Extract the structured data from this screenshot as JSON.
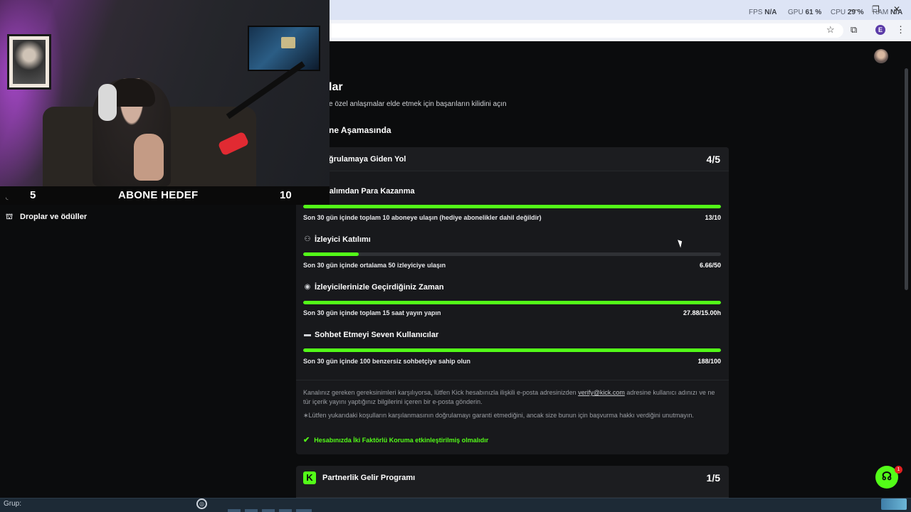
{
  "perf": {
    "fps_label": "FPS",
    "fps_value": "N/A",
    "gpu_label": "GPU",
    "gpu_value": "61 %",
    "cpu_label": "CPU",
    "cpu_value": "29 %",
    "ram_label": "RAM",
    "ram_value": "N/A"
  },
  "browser": {
    "profile_initial": "E",
    "window_controls": {
      "minimize": "—",
      "restore": "❐",
      "close": "✕"
    }
  },
  "page": {
    "title": "lar",
    "subtitle": "e özel anlaşmalar elde etmek için başarıların kilidini açın",
    "stage": "ne Aşamasında"
  },
  "card": {
    "title": "ğrulamaya Giden Yol",
    "count": "4/5",
    "requirements": [
      {
        "icon": "sparkle-icon",
        "glyph": "✦",
        "title": "Kanalımdan Para Kazanma",
        "desc": "Son 30 gün içinde toplam 10 aboneye ulaşın (hediye abonelikler dahil değildir)",
        "value": "13/10",
        "progress": 1.0
      },
      {
        "icon": "viewers-icon",
        "glyph": "⚇",
        "title": "İzleyici Katılımı",
        "desc": "Son 30 gün içinde ortalama 50 izleyiciye ulaşın",
        "value": "6.66/50",
        "progress": 0.133
      },
      {
        "icon": "broadcast-icon",
        "glyph": "◉",
        "title": "İzleyicilerinizle Geçirdiğiniz Zaman",
        "desc": "Son 30 gün içinde toplam 15 saat yayın yapın",
        "value": "27.88/15.00h",
        "progress": 1.0
      },
      {
        "icon": "chat-icon",
        "glyph": "▬",
        "title": "Sohbet Etmeyi Seven Kullanıcılar",
        "desc": "Son 30 gün içinde 100 benzersiz sohbetçiye sahip olun",
        "value": "188/100",
        "progress": 1.0
      }
    ],
    "note1_a": "Kanalınız gereken gereksinimleri karşılıyorsa, lütfen Kick hesabınızla ilişkili e-posta adresinizden ",
    "note1_link": "verify@kick.com",
    "note1_b": " adresine kullanıcı adınızı ve ne tür içerik yayını yaptığınız bilgilerini içeren bir e-posta gönderin.",
    "note2": "∗Lütfen yukarıdaki koşulların karşılanmasının doğrulamayı garanti etmediğini, ancak size bunun için başvurma hakkı verdiğini unutmayın.",
    "check": "Hesabınızda İki Faktörlü Koruma etkinleştirilmiş olmalıdır"
  },
  "card2": {
    "logo": "K",
    "title": "Partnerlik Gelir Programı",
    "count": "1/5"
  },
  "support": {
    "badge": "1"
  },
  "overlay": {
    "goal_left": "5",
    "goal_mid": "ABONE HEDEF",
    "goal_right": "10"
  },
  "sidebar": {
    "item": "Droplar ve ödüller"
  },
  "taskbar": {
    "label": "Grup:"
  },
  "colors": {
    "accent": "#53fc18",
    "background": "#0b0c0d",
    "card": "#18191c"
  }
}
